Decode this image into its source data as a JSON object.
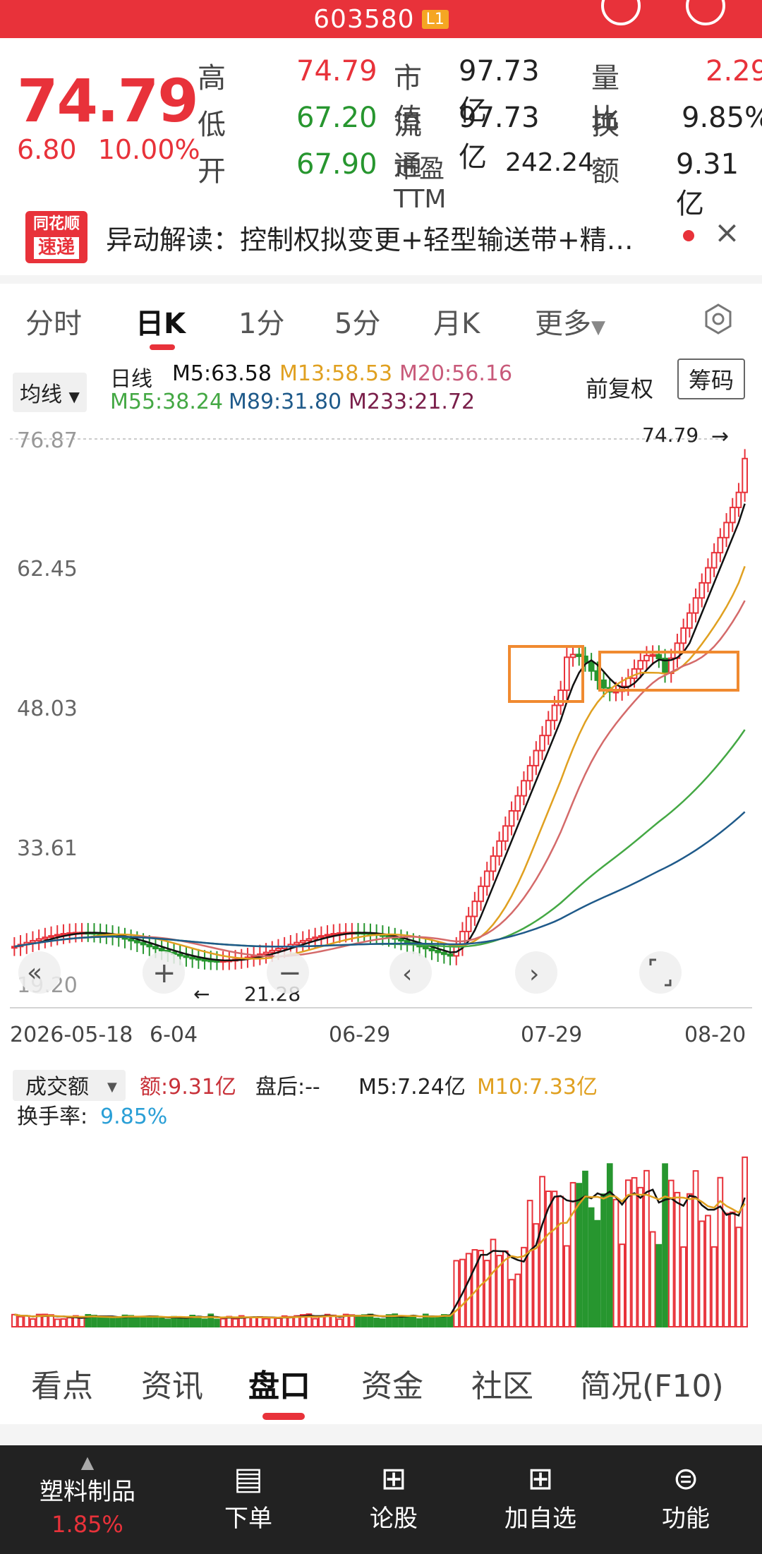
{
  "header": {
    "code": "603580",
    "badge": "L1"
  },
  "quote": {
    "price": "74.79",
    "change": "6.80",
    "change_pct": "10.00%",
    "rows": [
      {
        "l1": "高",
        "v1": "74.79",
        "l2": "市值",
        "v2": "97.73亿",
        "l3": "量比",
        "v3": "2.29"
      },
      {
        "l1": "低",
        "v1": "67.20",
        "l2": "流通",
        "v2": "97.73亿",
        "l3": "换",
        "v3": "9.85%"
      },
      {
        "l1": "开",
        "v1": "67.90",
        "l2": "市盈TTM",
        "v2": "242.24",
        "l3": "额",
        "v3": "9.31亿"
      }
    ]
  },
  "news": {
    "logo_top": "同花顺",
    "logo_bottom": "速递",
    "text": "异动解读：控制权拟变更+轻型输送带+精…"
  },
  "tabs": [
    "分时",
    "日K",
    "1分",
    "5分",
    "月K",
    "更多"
  ],
  "ma_header": {
    "selector": "均线",
    "period": "日线",
    "m5": "M5:63.58",
    "m13": "M13:58.53",
    "m20": "M20:56.16",
    "m55": "M55:38.24",
    "m89": "M89:31.80",
    "m233": "M233:21.72",
    "adjust": "前复权",
    "chips": "筹码"
  },
  "colors": {
    "up": "#e8323a",
    "down": "#27962f",
    "m5": "#111111",
    "m13": "#e0a020",
    "m20": "#d46a6a",
    "m55": "#44a844",
    "m89": "#1f5a8a",
    "m233": "#7a1f4a",
    "box": "#f08a30"
  },
  "chart_data": {
    "type": "candlestick",
    "y_ticks": [
      "76.87",
      "62.45",
      "48.03",
      "33.61",
      "19.20"
    ],
    "x_labels": [
      "2026-05-18",
      "6-04",
      "06-29",
      "07-29",
      "08-20"
    ],
    "high_marker": "74.79",
    "low_marker": "21.28",
    "ylim": [
      19.2,
      76.87
    ]
  },
  "volume": {
    "selector": "成交额",
    "amount": "额:9.31亿",
    "after": "盘后:--",
    "m5": "M5:7.24亿",
    "m10": "M10:7.33亿",
    "turnover_label": "换手率:",
    "turnover": "9.85%"
  },
  "bottom_tabs": [
    "看点",
    "资讯",
    "盘口",
    "资金",
    "社区",
    "简况(F10)"
  ],
  "dock": {
    "sector": "塑料制品",
    "sector_pct": "1.85%",
    "items": [
      "下单",
      "论股",
      "加自选",
      "功能"
    ]
  }
}
